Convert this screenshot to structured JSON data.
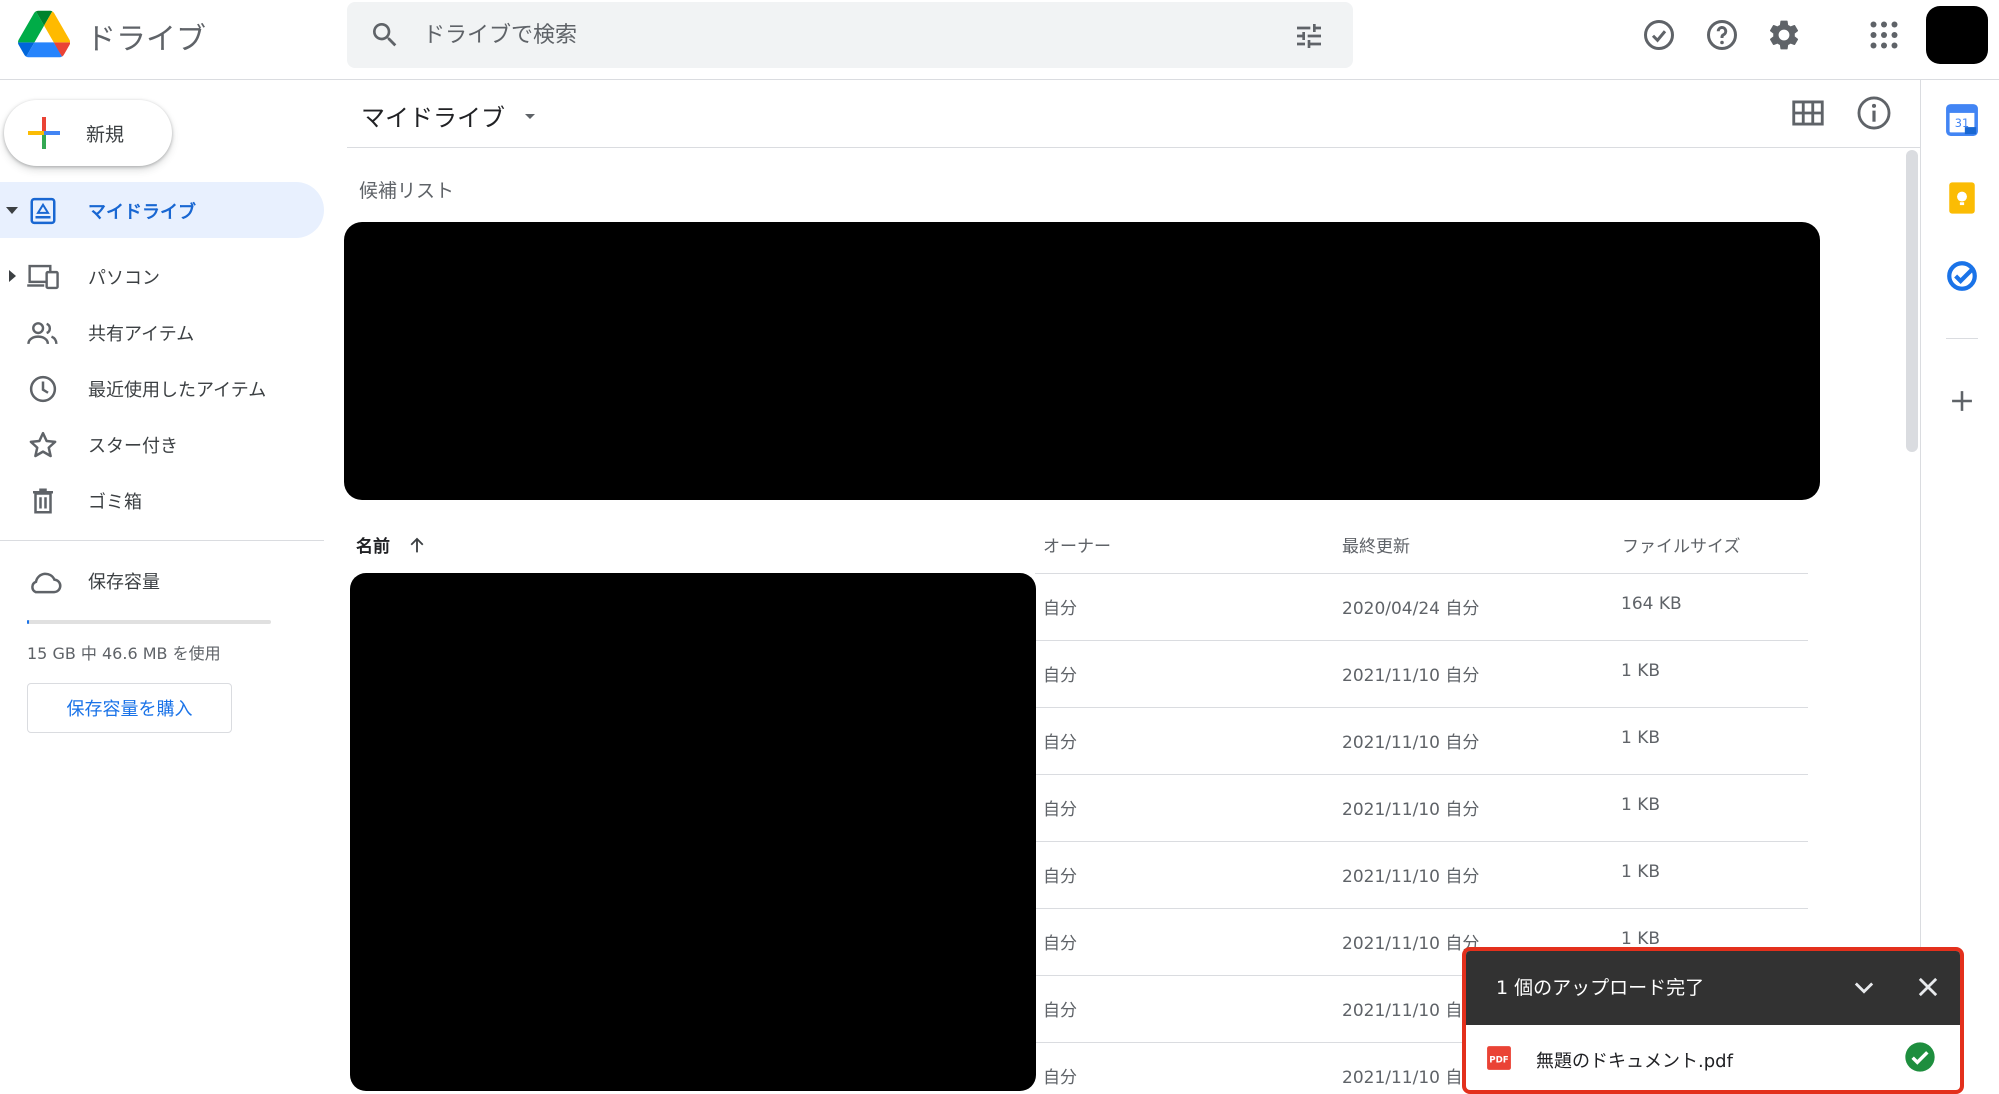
{
  "header": {
    "app_title": "ドライブ",
    "search_placeholder": "ドライブで検索",
    "icons": [
      "drive-logo",
      "search-icon",
      "search-options-icon",
      "offline-ready-icon",
      "help-icon",
      "settings-icon",
      "apps-grid-icon",
      "account-avatar"
    ]
  },
  "sidebar": {
    "new_label": "新規",
    "items": [
      {
        "label": "マイドライブ",
        "icon": "my-drive-icon",
        "active": true
      },
      {
        "label": "パソコン",
        "icon": "computers-icon",
        "active": false
      },
      {
        "label": "共有アイテム",
        "icon": "shared-icon",
        "active": false
      },
      {
        "label": "最近使用したアイテム",
        "icon": "recent-icon",
        "active": false
      },
      {
        "label": "スター付き",
        "icon": "star-icon",
        "active": false
      },
      {
        "label": "ゴミ箱",
        "icon": "trash-icon",
        "active": false
      }
    ],
    "storage": {
      "label": "保存容量",
      "used_text": "15 GB 中 46.6 MB を使用",
      "used_fraction": 0.003,
      "buy_label": "保存容量を購入"
    }
  },
  "main": {
    "title": "マイドライブ",
    "suggested_label": "候補リスト",
    "columns": {
      "name": "名前",
      "owner": "オーナー",
      "modified": "最終更新",
      "size": "ファイルサイズ"
    },
    "rows": [
      {
        "owner": "自分",
        "modified": "2020/04/24 自分",
        "size": "164 KB"
      },
      {
        "owner": "自分",
        "modified": "2021/11/10 自分",
        "size": "1 KB"
      },
      {
        "owner": "自分",
        "modified": "2021/11/10 自分",
        "size": "1 KB"
      },
      {
        "owner": "自分",
        "modified": "2021/11/10 自分",
        "size": "1 KB"
      },
      {
        "owner": "自分",
        "modified": "2021/11/10 自分",
        "size": "1 KB"
      },
      {
        "owner": "自分",
        "modified": "2021/11/10 自分",
        "size": "1 KB"
      },
      {
        "owner": "自分",
        "modified": "2021/11/10 自分",
        "size": ""
      },
      {
        "owner": "自分",
        "modified": "2021/11/10 自分",
        "size": ""
      }
    ]
  },
  "rightbar": {
    "icons": [
      "calendar-icon",
      "keep-icon",
      "tasks-icon",
      "add-addon-icon"
    ],
    "calendar_number": "31"
  },
  "upload_toast": {
    "title": "1 個のアップロード完了",
    "file_badge": "PDF",
    "file_name": "無題のドキュメント.pdf",
    "status_color": "#1e8e3e"
  }
}
